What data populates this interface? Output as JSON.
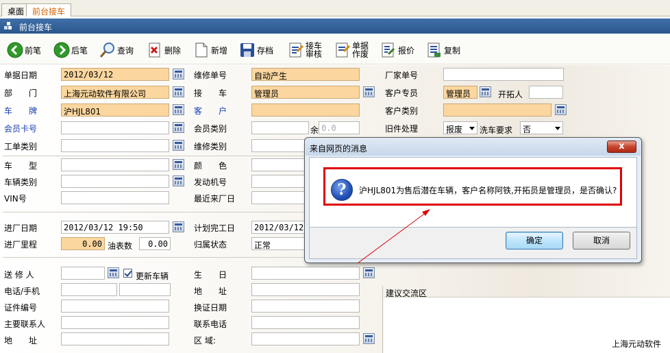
{
  "tabs": [
    {
      "label": "桌面"
    },
    {
      "label": "前台接车"
    }
  ],
  "window": {
    "title": "前台接车"
  },
  "toolbar": {
    "prev": "前笔",
    "next": "后笔",
    "query": "查询",
    "delete": "删除",
    "new": "新增",
    "save": "存档",
    "audit": "接车\n审核",
    "void": "单据\n作废",
    "quote": "报价",
    "copy": "复制"
  },
  "form": {
    "doc_date": {
      "label": "单据日期",
      "value": "2012/03/12"
    },
    "repair_no": {
      "label": "维修单号",
      "value": "自动产生"
    },
    "factory_no": {
      "label": "厂家单号",
      "value": ""
    },
    "department": {
      "label": "部　　门",
      "value": "上海元动软件有限公司"
    },
    "receiver": {
      "label": "接　　车",
      "value": "管理员"
    },
    "customer_agent": {
      "label": "客户专员",
      "value": "管理员"
    },
    "developer": {
      "label": "开拓人",
      "value": ""
    },
    "plate": {
      "label": "车　　牌",
      "value": "沪HJL801"
    },
    "customer": {
      "label": "客　　户",
      "value": ""
    },
    "customer_type": {
      "label": "客户类别",
      "value": ""
    },
    "member_card": {
      "label": "会员卡号",
      "value": ""
    },
    "member_type": {
      "label": "会员类别",
      "value": ""
    },
    "balance": {
      "label": "余",
      "value": "0.0"
    },
    "old_parts": {
      "label": "旧件处理",
      "value": "报废"
    },
    "wash": {
      "label": "洗车要求",
      "value": "否"
    },
    "work_type": {
      "label": "工单类别",
      "value": ""
    },
    "repair_type": {
      "label": "维修类别",
      "value": ""
    },
    "model": {
      "label": "车　　型",
      "value": ""
    },
    "color": {
      "label": "颜　　色",
      "value": ""
    },
    "vehicle_type": {
      "label": "车辆类别",
      "value": ""
    },
    "engine_no": {
      "label": "发动机号",
      "value": ""
    },
    "vin": {
      "label": "VIN号",
      "value": ""
    },
    "last_visit": {
      "label": "最近来厂日",
      "value": ""
    },
    "in_date": {
      "label": "进厂日期",
      "value": "2012/03/12 19:50"
    },
    "plan_done": {
      "label": "计划完工日",
      "value": "2012/03/12 2"
    },
    "mileage": {
      "label": "进厂里程",
      "value": "0.00"
    },
    "fuel": {
      "label": "油表数",
      "value": "0.00"
    },
    "status": {
      "label": "归属状态",
      "value": "正常"
    },
    "sender": {
      "label": "送 修 人",
      "value": ""
    },
    "update_vehicle": {
      "label": "更新车辆"
    },
    "birthday": {
      "label": "生　　日",
      "value": ""
    },
    "phone": {
      "label": "电话/手机",
      "value": ""
    },
    "address1": {
      "label": "地　　址",
      "value": ""
    },
    "id_no": {
      "label": "证件编号",
      "value": ""
    },
    "renew_date": {
      "label": "换证日期",
      "value": ""
    },
    "contact": {
      "label": "主要联系人",
      "value": ""
    },
    "contact_phone": {
      "label": "联系电话",
      "value": ""
    },
    "address2": {
      "label": "地　　址",
      "value": ""
    },
    "region": {
      "label": "区 域:",
      "value": ""
    },
    "suggest": {
      "label": "建议交流区"
    },
    "footer_brand": "上海元动软件"
  },
  "dialog": {
    "title": "来自网页的消息",
    "close": "x",
    "message": "沪HJL801为售后潜在车辆，客户名称阿铁,开拓员是管理员，是否确认?",
    "ok": "确定",
    "cancel": "取消"
  },
  "colors": {
    "title_bar": "#2b568c",
    "required_field": "#fbd79f",
    "label_blue": "#1a3fb0",
    "highlight_red": "#e00000"
  }
}
